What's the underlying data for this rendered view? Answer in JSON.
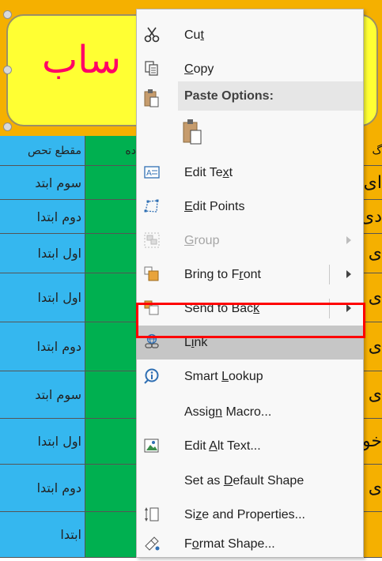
{
  "sheet": {
    "shape_text": "ساب",
    "header": {
      "col_a": "مقطع تحص",
      "col_b": "ده",
      "col_c": "گ"
    },
    "rows": [
      {
        "col_a": "سوم ابتد",
        "col_c": "ای"
      },
      {
        "col_a": "دوم ابتدا",
        "col_c": "دی"
      },
      {
        "col_a": "اول ابتدا",
        "col_c": "ی"
      },
      {
        "col_a": "اول ابتدا",
        "col_c": "ی"
      },
      {
        "col_a": "دوم ابتدا",
        "col_c": "ی"
      },
      {
        "col_a": "سوم ابتد",
        "col_c": "ی"
      },
      {
        "col_a": "اول ابتدا",
        "col_c": "خو"
      },
      {
        "col_a": "دوم ابتدا",
        "col_c": "ی"
      },
      {
        "col_a": "ابتدا",
        "col_c": ""
      }
    ],
    "colors": {
      "band": "#f5b000",
      "shape_fill": "#ffff33",
      "shape_text": "#ff0066",
      "col_a": "#35b7ef",
      "col_b": "#00b050"
    }
  },
  "menu": {
    "cut": {
      "pre": "Cu",
      "ul": "t",
      "post": ""
    },
    "copy": {
      "pre": "",
      "ul": "C",
      "post": "opy"
    },
    "paste_options": "Paste Options:",
    "edit_text": {
      "pre": "Edit Te",
      "ul": "x",
      "post": "t"
    },
    "edit_points": {
      "pre": "",
      "ul": "E",
      "post": "dit Points"
    },
    "group": {
      "pre": "",
      "ul": "G",
      "post": "roup"
    },
    "bring_to_front": {
      "pre": "Bring to F",
      "ul": "r",
      "post": "ont"
    },
    "send_to_back": {
      "pre": "Send to Bac",
      "ul": "k",
      "post": ""
    },
    "link": {
      "pre": "L",
      "ul": "i",
      "post": "nk"
    },
    "smart_lookup": {
      "pre": "Smart ",
      "ul": "L",
      "post": "ookup"
    },
    "assign_macro": {
      "pre": "Assig",
      "ul": "n",
      "post": " Macro..."
    },
    "edit_alt_text": {
      "pre": "Edit ",
      "ul": "A",
      "post": "lt Text..."
    },
    "set_default_shape": {
      "pre": "Set as ",
      "ul": "D",
      "post": "efault Shape"
    },
    "size_properties": {
      "pre": "Si",
      "ul": "z",
      "post": "e and Properties..."
    },
    "format_shape": {
      "pre": "F",
      "ul": "o",
      "post": "rmat Shape..."
    },
    "icons": [
      "scissors-icon",
      "copy-icon",
      "paste-icon",
      "paste-keep-source-icon",
      "edit-text-icon",
      "edit-points-icon",
      "group-icon",
      "bring-to-front-icon",
      "send-to-back-icon",
      "link-icon",
      "smart-lookup-icon",
      "edit-alt-text-icon",
      "size-properties-icon",
      "format-shape-icon"
    ],
    "highlight_color": "#c6c6c6",
    "focus_border": "#ff0000"
  }
}
